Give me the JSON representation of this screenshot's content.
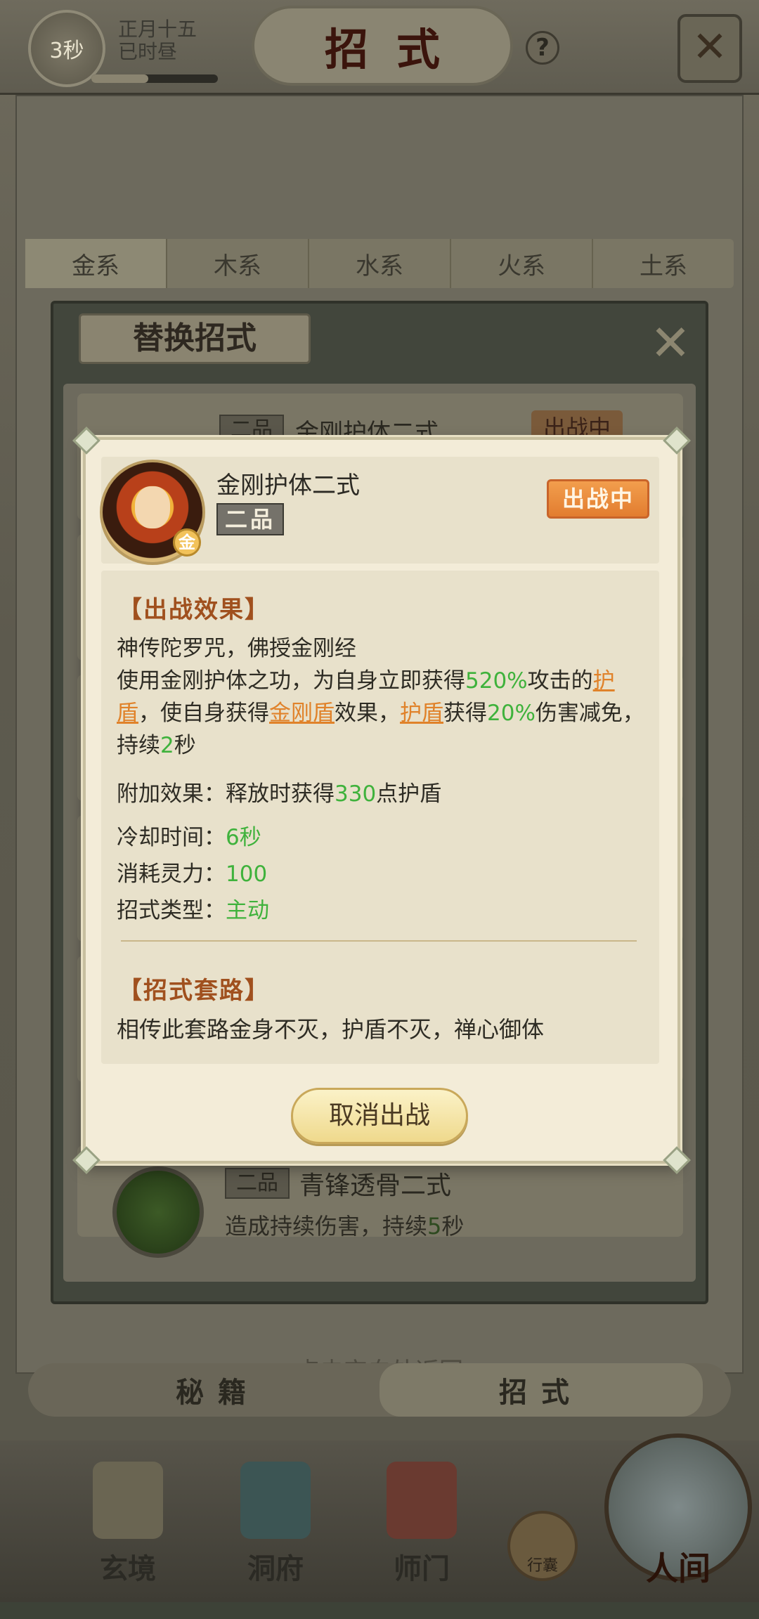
{
  "topbar": {
    "timer": "3秒",
    "date_line1": "正月十五",
    "date_line2": "已时昼",
    "title": "招式",
    "help_symbol": "?"
  },
  "element_tabs": [
    "金系",
    "木系",
    "水系",
    "火系",
    "土系"
  ],
  "replace_dialog": {
    "title": "替换招式",
    "row1": {
      "grade": "二品",
      "name": "金刚护体二式",
      "status": "出战中"
    },
    "row2": {
      "grade": "二品",
      "name": "青锋透骨二式",
      "desc_prefix": "造成持续伤害，持续",
      "desc_value": "5",
      "desc_suffix": "秒"
    }
  },
  "tap_back_hint": "点击空白处返回",
  "bottom_tabs": [
    "秘籍",
    "招式"
  ],
  "nav": {
    "items": [
      "玄境",
      "洞府",
      "师门"
    ],
    "bag": "行囊",
    "world": "人间"
  },
  "popup": {
    "skill_name": "金刚护体二式",
    "grade": "二品",
    "element": "金",
    "status": "出战中",
    "effect_title": "【出战效果】",
    "effect": {
      "line1": "神传陀罗咒，佛授金刚经",
      "p1": "使用金刚护体之功，为自身立即获得",
      "v1": "520%",
      "p2": "攻击的",
      "k1": "护盾",
      "p3": "，使自身获得",
      "k2": "金刚盾",
      "p4": "效果，",
      "k3": "护盾",
      "p5": "获得",
      "v2": "20%",
      "p6": "伤害减免，持续",
      "v3": "2",
      "p7": "秒"
    },
    "extra": {
      "label": "附加效果：释放时获得",
      "value": "330",
      "suffix": "点护盾"
    },
    "cooldown": {
      "label": "冷却时间：",
      "value": "6秒"
    },
    "cost": {
      "label": "消耗灵力：",
      "value": "100"
    },
    "type": {
      "label": "招式类型：",
      "value": "主动"
    },
    "routine_title": "【招式套路】",
    "routine_text": "相传此套路金身不灭，护盾不灭，禅心御体",
    "cancel_button": "取消出战"
  },
  "colors": {
    "highlight_green": "#3fb23c",
    "keyword_orange": "#e0822a",
    "section_title": "#a0501e",
    "status_orange": "#e8862f"
  }
}
